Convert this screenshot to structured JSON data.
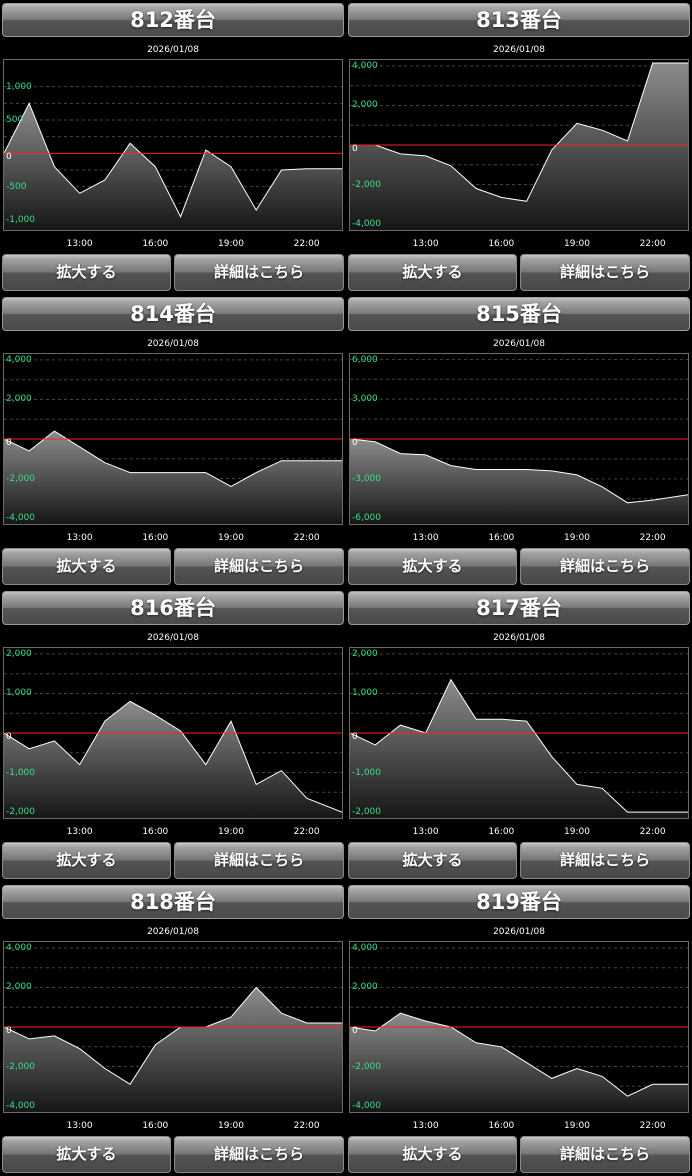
{
  "buttons": {
    "zoom": "拡大する",
    "detail": "詳細はこちら"
  },
  "chart_data": [
    {
      "type": "area",
      "title": "812番台",
      "date": "2026/01/08",
      "y_ticks": [
        "1,000",
        "500",
        "0",
        "-500",
        "-1,000"
      ],
      "y_tick_values": [
        1000,
        500,
        0,
        -500,
        -1000
      ],
      "ylim": [
        -1150,
        1400
      ],
      "x_ticks": [
        "13:00",
        "16:00",
        "19:00",
        "22:00"
      ],
      "x_tick_values": [
        13,
        16,
        19,
        22
      ],
      "xlim": [
        10,
        23.4
      ],
      "grid": true,
      "x": [
        10,
        11,
        12,
        13,
        14,
        15,
        16,
        17,
        18,
        19,
        20,
        21,
        22,
        23.4
      ],
      "values": [
        0,
        750,
        -200,
        -600,
        -400,
        150,
        -200,
        -950,
        50,
        -200,
        -850,
        -250,
        -230,
        -230
      ]
    },
    {
      "type": "area",
      "title": "813番台",
      "date": "2026/01/08",
      "y_ticks": [
        "4,000",
        "2,000",
        "0",
        "-2,000",
        "-4,000"
      ],
      "y_tick_values": [
        4000,
        2000,
        0,
        -2000,
        -4000
      ],
      "ylim": [
        -4300,
        4300
      ],
      "x_ticks": [
        "13:00",
        "16:00",
        "19:00",
        "22:00"
      ],
      "x_tick_values": [
        13,
        16,
        19,
        22
      ],
      "xlim": [
        10,
        23.4
      ],
      "grid": true,
      "x": [
        10,
        11,
        12,
        13,
        14,
        15,
        16,
        17,
        18,
        19,
        20,
        21,
        22,
        23.4
      ],
      "values": [
        0,
        0,
        -450,
        -550,
        -1050,
        -2200,
        -2650,
        -2850,
        -250,
        1100,
        750,
        200,
        4150,
        4150
      ]
    },
    {
      "type": "area",
      "title": "814番台",
      "date": "2026/01/08",
      "y_ticks": [
        "4,000",
        "2,000",
        "0",
        "-2,000",
        "-4,000"
      ],
      "y_tick_values": [
        4000,
        2000,
        0,
        -2000,
        -4000
      ],
      "ylim": [
        -4300,
        4300
      ],
      "x_ticks": [
        "13:00",
        "16:00",
        "19:00",
        "22:00"
      ],
      "x_tick_values": [
        13,
        16,
        19,
        22
      ],
      "xlim": [
        10,
        23.4
      ],
      "grid": true,
      "x": [
        10,
        11,
        12,
        13,
        14,
        15,
        16,
        17,
        18,
        19,
        20,
        21,
        22,
        23.4
      ],
      "values": [
        0,
        -600,
        400,
        -400,
        -1200,
        -1700,
        -1700,
        -1700,
        -1700,
        -2400,
        -1700,
        -1100,
        -1100,
        -1100
      ]
    },
    {
      "type": "area",
      "title": "815番台",
      "date": "2026/01/08",
      "y_ticks": [
        "6,000",
        "3,000",
        "0",
        "-3,000",
        "-6,000"
      ],
      "y_tick_values": [
        6000,
        3000,
        0,
        -3000,
        -6000
      ],
      "ylim": [
        -6400,
        6400
      ],
      "x_ticks": [
        "13:00",
        "16:00",
        "19:00",
        "22:00"
      ],
      "x_tick_values": [
        13,
        16,
        19,
        22
      ],
      "xlim": [
        10,
        23.4
      ],
      "grid": true,
      "x": [
        10,
        11,
        12,
        13,
        14,
        15,
        16,
        17,
        18,
        19,
        20,
        21,
        22,
        23.4
      ],
      "values": [
        0,
        -200,
        -1100,
        -1200,
        -2000,
        -2300,
        -2300,
        -2300,
        -2400,
        -2700,
        -3600,
        -4800,
        -4600,
        -4200
      ]
    },
    {
      "type": "area",
      "title": "816番台",
      "date": "2026/01/08",
      "y_ticks": [
        "2,000",
        "1,000",
        "0",
        "-1,000",
        "-2,000"
      ],
      "y_tick_values": [
        2000,
        1000,
        0,
        -1000,
        -2000
      ],
      "ylim": [
        -2150,
        2150
      ],
      "x_ticks": [
        "13:00",
        "16:00",
        "19:00",
        "22:00"
      ],
      "x_tick_values": [
        13,
        16,
        19,
        22
      ],
      "xlim": [
        10,
        23.4
      ],
      "grid": true,
      "x": [
        10,
        11,
        12,
        13,
        14,
        15,
        16,
        17,
        18,
        19,
        20,
        21,
        22,
        23.4
      ],
      "values": [
        0,
        -400,
        -200,
        -800,
        300,
        800,
        450,
        50,
        -800,
        300,
        -1300,
        -950,
        -1650,
        -2000
      ]
    },
    {
      "type": "area",
      "title": "817番台",
      "date": "2026/01/08",
      "y_ticks": [
        "2,000",
        "1,000",
        "0",
        "-1,000",
        "-2,000"
      ],
      "y_tick_values": [
        2000,
        1000,
        0,
        -1000,
        -2000
      ],
      "ylim": [
        -2150,
        2150
      ],
      "x_ticks": [
        "13:00",
        "16:00",
        "19:00",
        "22:00"
      ],
      "x_tick_values": [
        13,
        16,
        19,
        22
      ],
      "xlim": [
        10,
        23.4
      ],
      "grid": true,
      "x": [
        10,
        11,
        12,
        13,
        14,
        15,
        16,
        17,
        18,
        19,
        20,
        21,
        22,
        23.4
      ],
      "values": [
        0,
        -300,
        200,
        0,
        1350,
        350,
        350,
        300,
        -600,
        -1300,
        -1400,
        -2000,
        -2000,
        -2000
      ]
    },
    {
      "type": "area",
      "title": "818番台",
      "date": "2026/01/08",
      "y_ticks": [
        "4,000",
        "2,000",
        "0",
        "-2,000",
        "-4,000"
      ],
      "y_tick_values": [
        4000,
        2000,
        0,
        -2000,
        -4000
      ],
      "ylim": [
        -4300,
        4300
      ],
      "x_ticks": [
        "13:00",
        "16:00",
        "19:00",
        "22:00"
      ],
      "x_tick_values": [
        13,
        16,
        19,
        22
      ],
      "xlim": [
        10,
        23.4
      ],
      "grid": true,
      "x": [
        10,
        11,
        12,
        13,
        14,
        15,
        16,
        17,
        18,
        19,
        20,
        21,
        22,
        23.4
      ],
      "values": [
        0,
        -600,
        -450,
        -1100,
        -2100,
        -2900,
        -900,
        0,
        0,
        500,
        2000,
        700,
        200,
        200
      ]
    },
    {
      "type": "area",
      "title": "819番台",
      "date": "2026/01/08",
      "y_ticks": [
        "4,000",
        "2,000",
        "0",
        "-2,000",
        "-4,000"
      ],
      "y_tick_values": [
        4000,
        2000,
        0,
        -2000,
        -4000
      ],
      "ylim": [
        -4300,
        4300
      ],
      "x_ticks": [
        "13:00",
        "16:00",
        "19:00",
        "22:00"
      ],
      "x_tick_values": [
        13,
        16,
        19,
        22
      ],
      "xlim": [
        10,
        23.4
      ],
      "grid": true,
      "x": [
        10,
        11,
        12,
        13,
        14,
        15,
        16,
        17,
        18,
        19,
        20,
        21,
        22,
        23.4
      ],
      "values": [
        0,
        -200,
        700,
        300,
        0,
        -800,
        -1000,
        -1800,
        -2600,
        -2100,
        -2500,
        -3500,
        -2900,
        -2900
      ]
    }
  ],
  "colors": {
    "area_top": "#8c8c8c",
    "area_bottom": "#161616",
    "line": "#ffffff",
    "zero_line": "#ff2020",
    "grid": "#444444",
    "y_label": "#35e08a"
  }
}
